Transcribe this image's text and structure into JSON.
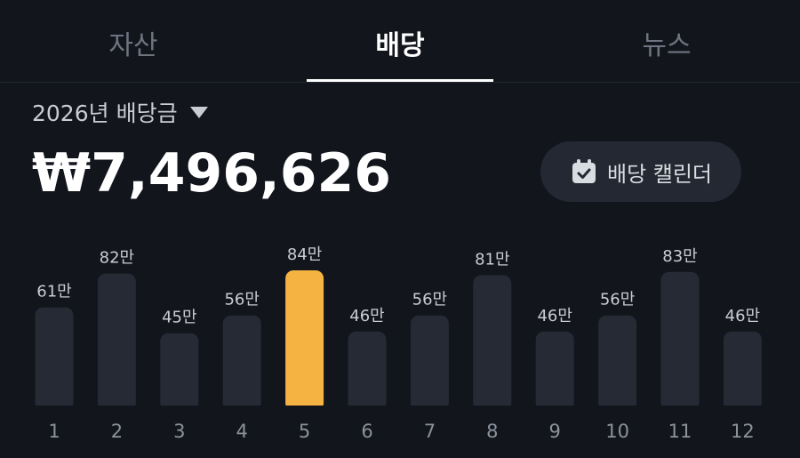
{
  "tabs": [
    {
      "label": "자산",
      "active": false
    },
    {
      "label": "배당",
      "active": true
    },
    {
      "label": "뉴스",
      "active": false
    }
  ],
  "year_selector": {
    "label": "2026년 배당금"
  },
  "total": {
    "value": "₩7,496,626"
  },
  "calendar_button": {
    "label": "배당 캘린더",
    "icon": "calendar-check-icon"
  },
  "colors": {
    "bar": "#252a35",
    "highlight": "#f5b341",
    "label": "#c9ccd2",
    "tick": "#8c929c"
  },
  "chart_data": {
    "type": "bar",
    "categories": [
      "1",
      "2",
      "3",
      "4",
      "5",
      "6",
      "7",
      "8",
      "9",
      "10",
      "11",
      "12"
    ],
    "values": [
      61,
      82,
      45,
      56,
      84,
      46,
      56,
      81,
      46,
      56,
      83,
      46
    ],
    "labels": [
      "61만",
      "82만",
      "45만",
      "56만",
      "84만",
      "46만",
      "56만",
      "81만",
      "46만",
      "56만",
      "83만",
      "46만"
    ],
    "highlight_index": 4,
    "ylim": [
      0,
      84
    ],
    "grid": false
  }
}
